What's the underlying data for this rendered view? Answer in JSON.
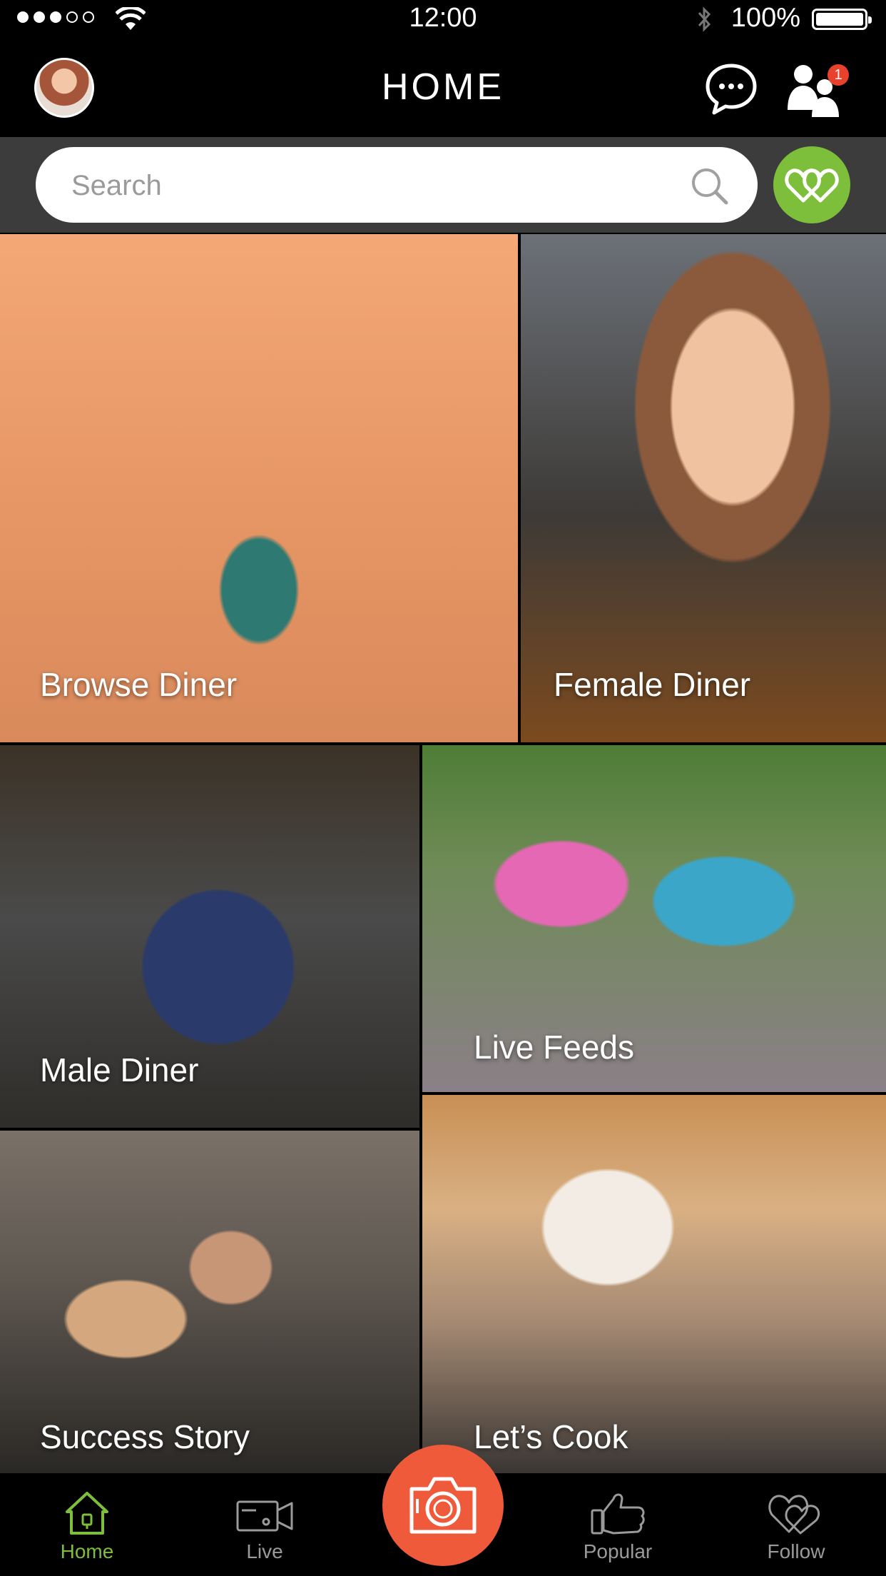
{
  "status_bar": {
    "time": "12:00",
    "battery": "100%",
    "signal_dots_on": 3,
    "signal_dots_total": 5
  },
  "header": {
    "title": "HOME",
    "notification_count": "1"
  },
  "search": {
    "placeholder": "Search"
  },
  "tiles": {
    "browse": "Browse Diner",
    "female": "Female Diner",
    "male": "Male Diner",
    "live": "Live Feeds",
    "success": "Success Story",
    "cook": "Let’s Cook"
  },
  "tabbar": {
    "items": [
      {
        "label": "Home",
        "icon": "home-icon",
        "active": true
      },
      {
        "label": "Live",
        "icon": "video-camera-icon",
        "active": false
      },
      {
        "label": "Popular",
        "icon": "thumbs-up-icon",
        "active": false
      },
      {
        "label": "Follow",
        "icon": "double-heart-icon",
        "active": false
      }
    ],
    "center_icon": "camera-icon"
  },
  "colors": {
    "accent_green": "#7dbf3a",
    "camera_orange": "#ef5a3b",
    "badge_red": "#e8412c",
    "search_bar_bg": "#3c3c3c"
  }
}
